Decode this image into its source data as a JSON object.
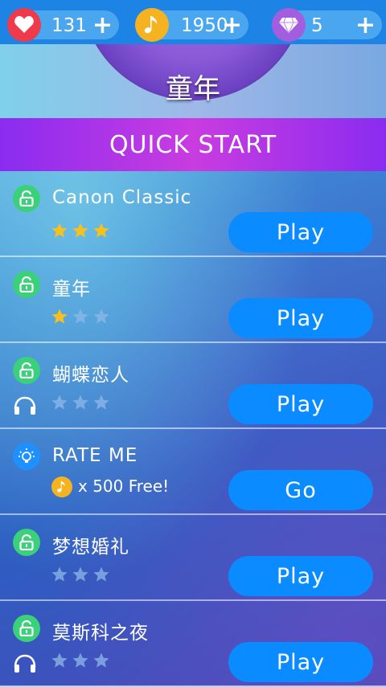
{
  "topbar": {
    "lives": {
      "value": "131",
      "plus": "+",
      "icon": "heart-icon",
      "color": "#ee3a4a"
    },
    "notes": {
      "value": "1950",
      "plus": "+",
      "icon": "music-note-icon",
      "color": "#f6b321"
    },
    "gems": {
      "value": "5",
      "plus": "+",
      "icon": "diamond-icon",
      "color": "#a35ee0"
    }
  },
  "hero": {
    "title": "童年"
  },
  "quick_start": {
    "label": "QUICK START"
  },
  "songs": [
    {
      "title": "Canon Classic",
      "stars": 3,
      "button": "Play",
      "icon": "lock-open-icon",
      "headphones": false
    },
    {
      "title": "童年",
      "stars": 1,
      "button": "Play",
      "icon": "lock-open-icon",
      "headphones": false
    },
    {
      "title": "蝴蝶恋人",
      "stars": 0,
      "button": "Play",
      "icon": "lock-open-icon",
      "headphones": true
    },
    {
      "title": "RATE ME",
      "reward_x": "x 500 Free!",
      "button": "Go",
      "icon": "lightbulb-icon"
    },
    {
      "title": "梦想婚礼",
      "stars": 0,
      "button": "Play",
      "icon": "lock-open-icon",
      "headphones": false
    },
    {
      "title": "莫斯科之夜",
      "stars": 0,
      "button": "Play",
      "icon": "lock-open-icon",
      "headphones": true
    }
  ],
  "colors": {
    "accent": "#0a8bff",
    "quick_start": "#b43ce6",
    "star_on": "#f6c01e",
    "star_off": "#8fb8e8"
  }
}
